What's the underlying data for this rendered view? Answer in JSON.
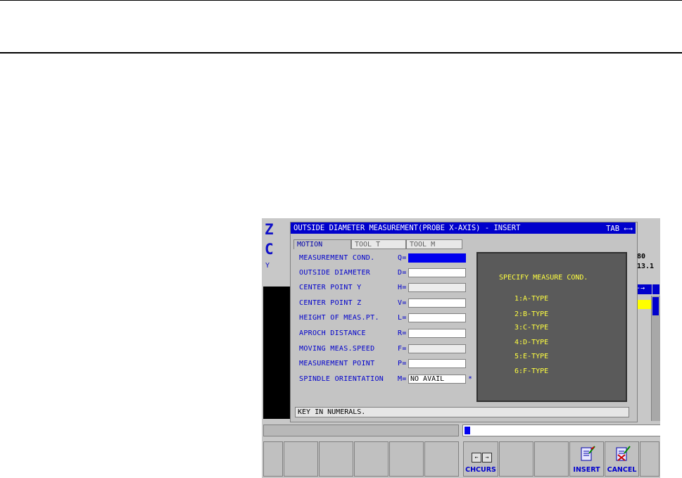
{
  "dialog": {
    "title": "OUTSIDE DIAMETER MEASUREMENT(PROBE X-AXIS) - INSERT",
    "tab_hint": "TAB ←→",
    "tabs": [
      {
        "label": "MOTION"
      },
      {
        "label": "TOOL T"
      },
      {
        "label": "TOOL M"
      }
    ],
    "fields": [
      {
        "label": "MEASUREMENT COND.",
        "code": "Q=",
        "value": ""
      },
      {
        "label": "OUTSIDE DIAMETER",
        "code": "D=",
        "value": ""
      },
      {
        "label": "CENTER POINT Y",
        "code": "H=",
        "value": ""
      },
      {
        "label": "CENTER POINT Z",
        "code": "V=",
        "value": ""
      },
      {
        "label": "HEIGHT OF MEAS.PT.",
        "code": "L=",
        "value": ""
      },
      {
        "label": "APROCH DISTANCE",
        "code": "R=",
        "value": ""
      },
      {
        "label": "MOVING MEAS.SPEED",
        "code": "F=",
        "value": ""
      },
      {
        "label": "MEASUREMENT POINT",
        "code": "P=",
        "value": ""
      },
      {
        "label": "SPINDLE ORIENTATION",
        "code": "M=",
        "value": "NO AVAIL",
        "mark": "*"
      }
    ],
    "help": {
      "title": "SPECIFY MEASURE COND.",
      "items": [
        "1:A-TYPE",
        "2:B-TYPE",
        "3:C-TYPE",
        "4:D-TYPE",
        "5:E-TYPE",
        "6:F-TYPE"
      ]
    },
    "status": "KEY IN NUMERALS."
  },
  "background": {
    "letter1": "Z",
    "letter2": "C",
    "letter3": "Y",
    "num1": "80",
    "num2": "13.1",
    "arrow": "-→"
  },
  "softkeys": {
    "chcurs": "CHCURS",
    "insert": "INSERT",
    "cancel": "CANCEL"
  },
  "colors": {
    "accent": "#0000cc",
    "help_text": "#ffff40",
    "help_bg": "#5a5a5a"
  }
}
